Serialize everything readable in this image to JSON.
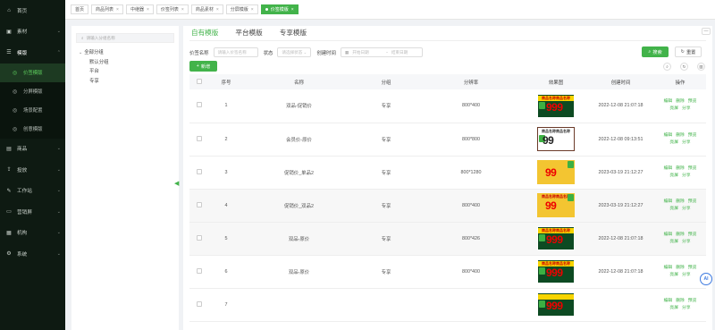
{
  "sidebar": {
    "items": [
      {
        "icon": "home-icon",
        "glyph": "⌂",
        "label": "首页",
        "chevron": ""
      },
      {
        "icon": "material-icon",
        "glyph": "▣",
        "label": "素材",
        "chevron": "⌄"
      },
      {
        "icon": "template-icon",
        "glyph": "☰",
        "label": "模版",
        "chevron": "⌃"
      }
    ],
    "sub_items": [
      {
        "icon": "price-tag-icon",
        "glyph": "◎",
        "label": "价签模版",
        "active": true
      },
      {
        "icon": "split-screen-icon",
        "glyph": "◎",
        "label": "分屏模版",
        "active": false
      },
      {
        "icon": "scene-icon",
        "glyph": "◎",
        "label": "场景配置",
        "active": false
      },
      {
        "icon": "creative-icon",
        "glyph": "◎",
        "label": "创意模版",
        "active": false
      }
    ],
    "items_bottom": [
      {
        "icon": "goods-icon",
        "glyph": "▤",
        "label": "商品",
        "chevron": "⌄"
      },
      {
        "icon": "delivery-icon",
        "glyph": "⇪",
        "label": "投放",
        "chevron": "⌄"
      },
      {
        "icon": "workbench-icon",
        "glyph": "✎",
        "label": "工作站",
        "chevron": "⌄"
      },
      {
        "icon": "marketing-icon",
        "glyph": "▭",
        "label": "营销屏",
        "chevron": "⌄"
      },
      {
        "icon": "org-icon",
        "glyph": "▦",
        "label": "机构",
        "chevron": "⌄"
      },
      {
        "icon": "system-icon",
        "glyph": "⚙",
        "label": "系统",
        "chevron": "⌄"
      }
    ]
  },
  "tabs": [
    {
      "label": "首页",
      "close": ""
    },
    {
      "label": "商品列表",
      "close": "×"
    },
    {
      "label": "中继器",
      "close": "×"
    },
    {
      "label": "价签列表",
      "close": "×"
    },
    {
      "label": "商品素材",
      "close": "×"
    },
    {
      "label": "分屏模版",
      "close": "×"
    },
    {
      "label": "价签模版",
      "close": "×",
      "active": true
    }
  ],
  "tree": {
    "search_placeholder": "请输入分组名称",
    "root": "全部分组",
    "children": [
      "默认分组",
      "平台",
      "专享"
    ]
  },
  "main": {
    "tabs": [
      "自有模版",
      "平台模版",
      "专享模版"
    ],
    "filter": {
      "name_label": "价签名称",
      "name_placeholder": "请输入价签名称",
      "status_label": "状态",
      "status_placeholder": "请选择状态",
      "time_label": "创建时间",
      "start_placeholder": "开始日期",
      "separator": "-",
      "end_placeholder": "结束日期"
    },
    "search_label": "搜索",
    "reset_label": "重置",
    "add_label": "新增",
    "columns": [
      "",
      "序号",
      "名称",
      "分组",
      "分辨率",
      "效果图",
      "创建时间",
      "操作"
    ],
    "ops": {
      "edit": "编辑",
      "delete": "删除",
      "preview": "预览",
      "publish": "亮屏",
      "share": "分享"
    },
    "rows": [
      {
        "no": "1",
        "name": "双品-促销价",
        "group": "专享",
        "res": "800*400",
        "style": "green",
        "thumb_title": "商品名称商品名称",
        "price": "999",
        "time": "2022-12-08 21:07:18"
      },
      {
        "no": "2",
        "name": "会员价-原价",
        "group": "专享",
        "res": "800*800",
        "style": "white",
        "thumb_title": "商品名称商品名称",
        "price": "99",
        "time": "2022-12-08 09:13:51"
      },
      {
        "no": "3",
        "name": "促销价_单品2",
        "group": "专享",
        "res": "800*1280",
        "style": "yellow",
        "thumb_title": "",
        "price": "99",
        "time": "2023-03-19 21:12:27"
      },
      {
        "no": "4",
        "name": "促销价_双品2",
        "group": "专享",
        "res": "800*400",
        "style": "yellow",
        "thumb_title": "商品名称商品名称",
        "price": "99",
        "time": "2023-03-19 21:12:27"
      },
      {
        "no": "5",
        "name": "双品-原价",
        "group": "专享",
        "res": "800*426",
        "style": "green",
        "thumb_title": "商品名称商品名称",
        "price": "999",
        "time": "2022-12-08 21:07:18"
      },
      {
        "no": "6",
        "name": "双品-原价",
        "group": "专享",
        "res": "800*400",
        "style": "green",
        "thumb_title": "商品名称商品名称",
        "price": "999",
        "time": "2022-12-08 21:07:18"
      },
      {
        "no": "7",
        "name": "",
        "group": "",
        "res": "",
        "style": "green",
        "thumb_title": "",
        "price": "999",
        "time": ""
      }
    ]
  },
  "ai_label": "AI",
  "colors": {
    "accent": "#42b34a",
    "sidebar_bg": "#0e1a12"
  }
}
